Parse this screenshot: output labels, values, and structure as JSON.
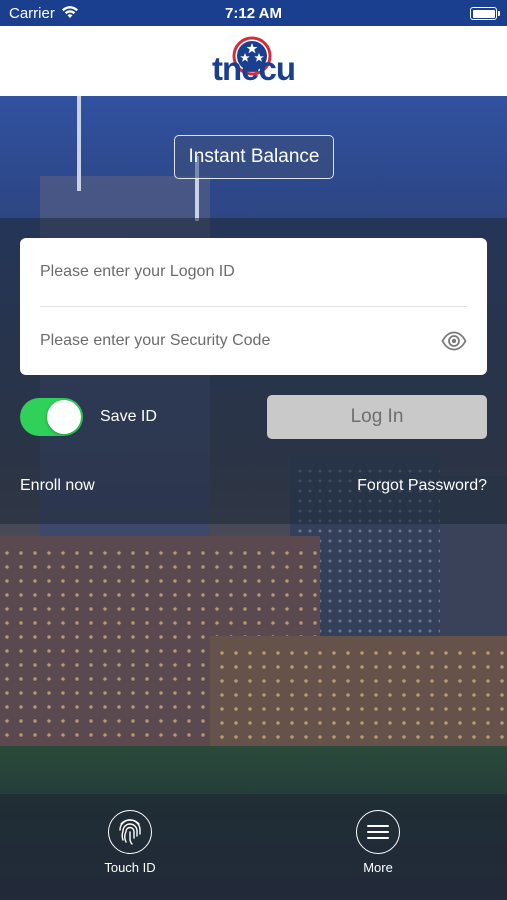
{
  "status_bar": {
    "carrier": "Carrier",
    "time": "7:12 AM"
  },
  "header": {
    "logo_text": "tnecu"
  },
  "instant_balance": {
    "label": "Instant Balance"
  },
  "login_form": {
    "logon_placeholder": "Please enter your Logon ID",
    "security_placeholder": "Please enter your Security Code",
    "save_id_label": "Save ID",
    "save_id_on": true,
    "login_label": "Log In"
  },
  "links": {
    "enroll": "Enroll now",
    "forgot": "Forgot Password?"
  },
  "bottom_bar": {
    "touch_id": "Touch ID",
    "more": "More"
  },
  "colors": {
    "brand_blue": "#1b3f8f",
    "toggle_green": "#2fd158",
    "logo_red": "#d62b3a"
  },
  "icons": [
    "wifi-icon",
    "battery-icon",
    "tristar-logo-icon",
    "eye-icon",
    "fingerprint-icon",
    "hamburger-menu-icon"
  ]
}
